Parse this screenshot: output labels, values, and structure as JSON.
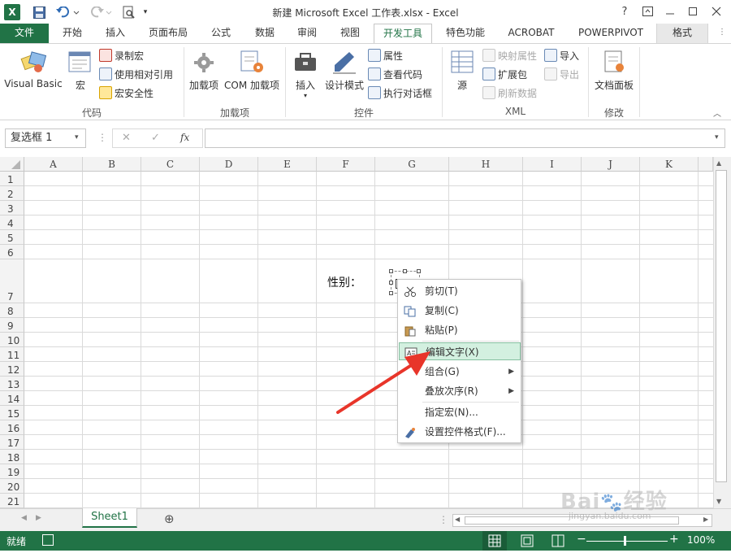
{
  "window": {
    "title": "新建 Microsoft Excel 工作表.xlsx - Excel",
    "help": "?",
    "controls": [
      "restore-ribbon",
      "minimize",
      "maximize",
      "close"
    ]
  },
  "quick_access": [
    "excel-logo-icon",
    "save-icon",
    "undo-icon",
    "redo-icon",
    "print-preview-icon",
    "customize-icon"
  ],
  "tabs": [
    {
      "label": "文件"
    },
    {
      "label": "开始"
    },
    {
      "label": "插入"
    },
    {
      "label": "页面布局"
    },
    {
      "label": "公式"
    },
    {
      "label": "数据"
    },
    {
      "label": "审阅"
    },
    {
      "label": "视图"
    },
    {
      "label": "开发工具",
      "active": true
    },
    {
      "label": "特色功能"
    },
    {
      "label": "ACROBAT"
    },
    {
      "label": "POWERPIVOT"
    },
    {
      "label": "格式"
    }
  ],
  "ribbon": {
    "groups": [
      {
        "label": "代码",
        "big": [
          "Visual Basic",
          "宏"
        ],
        "small": [
          "录制宏",
          "使用相对引用",
          "宏安全性"
        ]
      },
      {
        "label": "加载项",
        "big": [
          "加载项",
          "COM 加载项"
        ]
      },
      {
        "label": "控件",
        "big": [
          "插入",
          "设计模式"
        ],
        "small": [
          "属性",
          "查看代码",
          "执行对话框"
        ]
      },
      {
        "label": "XML",
        "big": [
          "源"
        ],
        "small": [
          "映射属性",
          "扩展包",
          "刷新数据",
          "导入",
          "导出"
        ]
      },
      {
        "label": "修改",
        "big": [
          "文档面板"
        ]
      }
    ]
  },
  "formula_bar": {
    "name_box": "复选框 1",
    "cancel": "✕",
    "enter": "✓",
    "fx": "fx",
    "value": ""
  },
  "grid": {
    "columns": [
      "A",
      "B",
      "C",
      "D",
      "E",
      "F",
      "G",
      "H",
      "I",
      "J",
      "K"
    ],
    "rows": [
      "1",
      "2",
      "3",
      "4",
      "5",
      "6",
      "7",
      "8",
      "9",
      "10",
      "11",
      "12",
      "13",
      "14",
      "15",
      "16",
      "17",
      "18",
      "19",
      "20",
      "21"
    ],
    "cell_f7": "性别："
  },
  "context_menu": {
    "items": [
      {
        "label": "剪切(T)",
        "icon": "scissors-icon"
      },
      {
        "label": "复制(C)",
        "icon": "copy-icon"
      },
      {
        "label": "粘贴(P)",
        "icon": "paste-icon"
      },
      {
        "label": "编辑文字(X)",
        "icon": "edit-text-icon",
        "highlighted": true
      },
      {
        "label": "组合(G)",
        "submenu": true
      },
      {
        "label": "叠放次序(R)",
        "submenu": true
      },
      {
        "label": "指定宏(N)..."
      },
      {
        "label": "设置控件格式(F)...",
        "icon": "format-control-icon"
      }
    ]
  },
  "sheets": {
    "tabs": [
      "Sheet1"
    ],
    "add": "⊕"
  },
  "status": {
    "ready": "就绪",
    "zoom": "100%",
    "minus": "−",
    "plus": "+"
  },
  "watermark": "Bai 经验 jingyan.baidu.com",
  "colors": {
    "excel_green": "#217346",
    "menu_highlight": "#d3f0e0",
    "arrow_red": "#e8352a"
  }
}
